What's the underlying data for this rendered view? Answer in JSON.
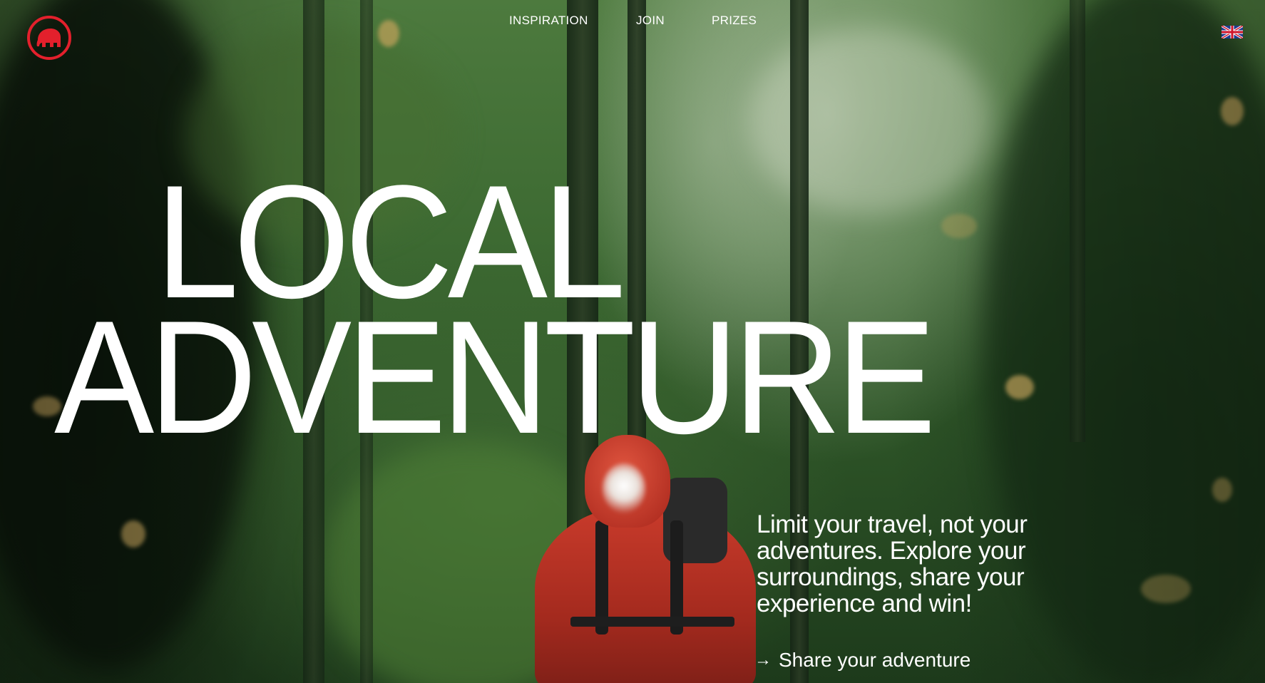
{
  "brand": {
    "logo_icon": "mammoth-logo-icon",
    "accent_color": "#e3202c"
  },
  "nav": {
    "items": [
      {
        "label": "INSPIRATION"
      },
      {
        "label": "JOIN"
      },
      {
        "label": "PRIZES"
      }
    ],
    "language_icon": "uk-flag-icon"
  },
  "hero": {
    "headline_line1": "LOCAL",
    "headline_line2": "ADVENTURE",
    "tagline": "Limit your travel, not your adventures. Explore your surroundings, share your experience and win!",
    "cta_label": "Share your adventure",
    "cta_icon": "arrow-right-icon",
    "background_image": "forest-hiker-photo"
  }
}
